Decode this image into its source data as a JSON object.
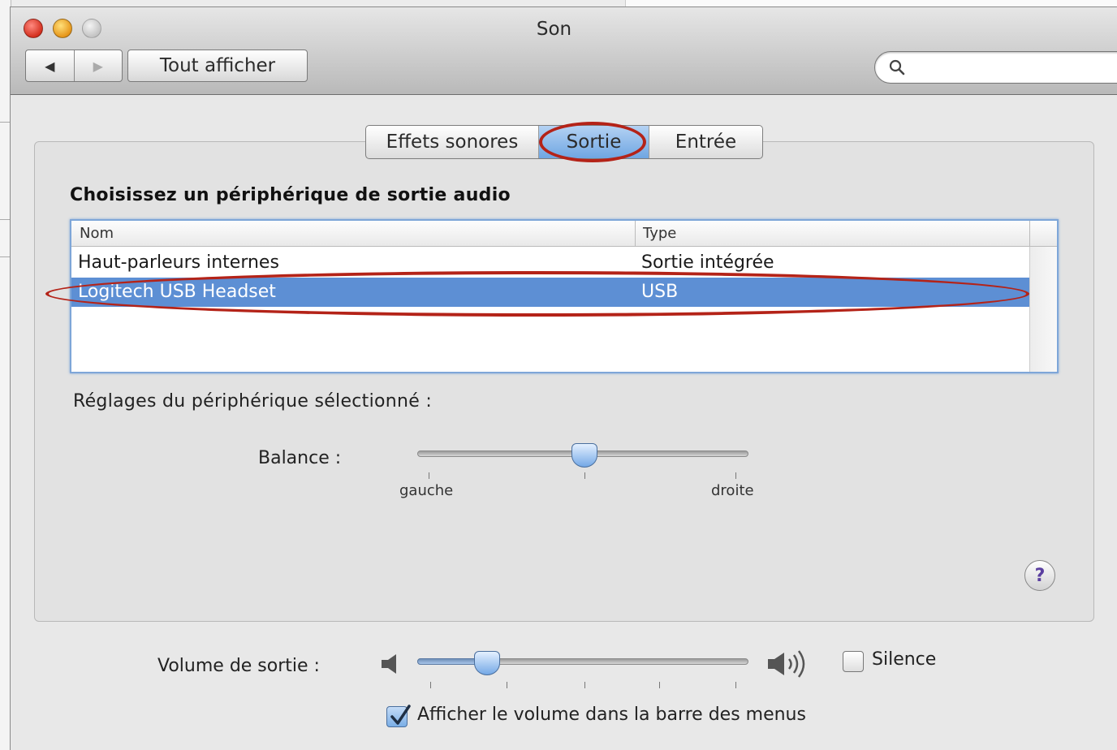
{
  "window": {
    "title": "Son"
  },
  "toolbar": {
    "back_label": "◀",
    "forward_label": "▶",
    "show_all_label": "Tout afficher",
    "search_value": ""
  },
  "tabs": [
    {
      "label": "Effets sonores",
      "selected": false
    },
    {
      "label": "Sortie",
      "selected": true
    },
    {
      "label": "Entrée",
      "selected": false
    }
  ],
  "output": {
    "heading": "Choisissez un périphérique de sortie audio",
    "columns": [
      "Nom",
      "Type"
    ],
    "devices": [
      {
        "name": "Haut-parleurs internes",
        "type": "Sortie intégrée",
        "selected": false
      },
      {
        "name": "Logitech USB Headset",
        "type": "USB",
        "selected": true
      }
    ]
  },
  "settings": {
    "heading": "Réglages du périphérique sélectionné :",
    "balance_label": "Balance :",
    "balance_value": 0.5,
    "left_label": "gauche",
    "right_label": "droite"
  },
  "help_label": "?",
  "volume": {
    "label": "Volume de sortie :",
    "level": 0.22,
    "mute_label": "Silence",
    "mute_checked": false,
    "menubar_label": "Afficher le volume dans la barre des menus",
    "menubar_checked": true
  },
  "colors": {
    "selection": "#5d8fd4",
    "annotation": "#b42318"
  }
}
